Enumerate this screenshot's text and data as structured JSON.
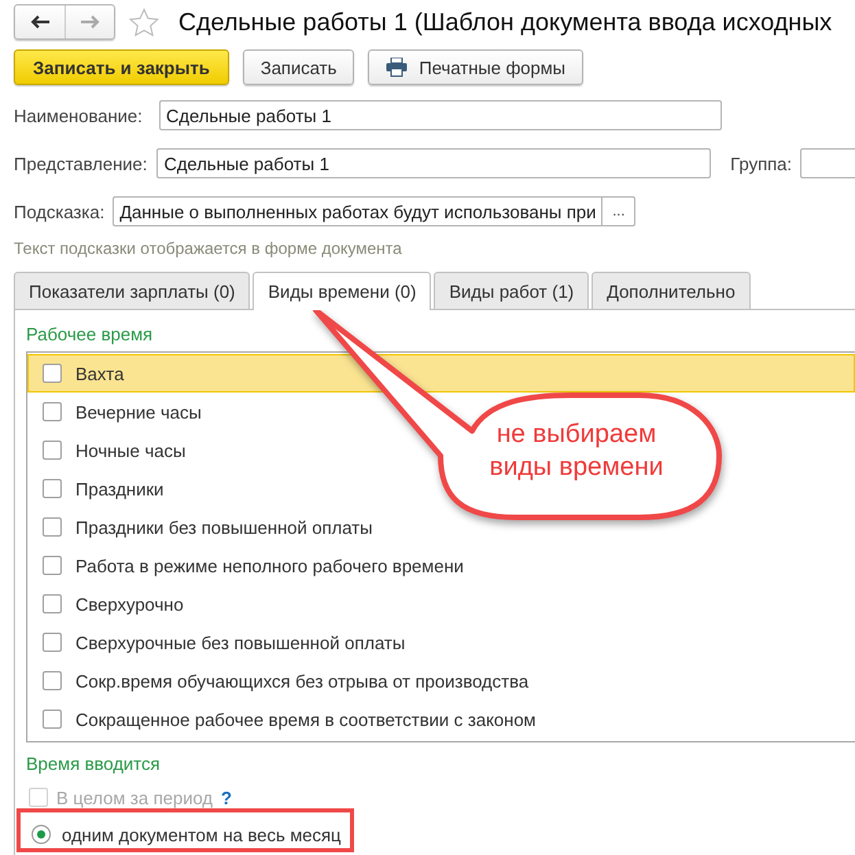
{
  "window": {
    "title": "Сдельные работы 1 (Шаблон документа ввода исходных"
  },
  "buttons": [
    {
      "label": "Записать и закрыть",
      "kind": "primary"
    },
    {
      "label": "Записать",
      "kind": "normal"
    },
    {
      "label": "Печатные формы",
      "kind": "print"
    }
  ],
  "fields": [
    {
      "label": "Наименование:",
      "value": "Сдельные работы 1"
    },
    {
      "label": "Представление:",
      "value": "Сдельные работы 1",
      "side_label": "Группа:"
    },
    {
      "label": "Подсказка:",
      "value": "Данные о выполненных работах будут использованы при",
      "button": "..."
    }
  ],
  "hint_note": "Текст подсказки отображается в форме документа",
  "tabs": [
    {
      "label": "Показатели зарплаты (0)",
      "selected": false
    },
    {
      "label": "Виды времени (0)",
      "selected": true
    },
    {
      "label": "Виды работ (1)",
      "selected": false
    },
    {
      "label": "Дополнительно",
      "selected": false
    }
  ],
  "working_time": {
    "title": "Рабочее время",
    "items": [
      {
        "label": "Вахта",
        "checked": false,
        "selected": true
      },
      {
        "label": "Вечерние часы",
        "checked": false,
        "selected": false
      },
      {
        "label": "Ночные часы",
        "checked": false,
        "selected": false
      },
      {
        "label": "Праздники",
        "checked": false,
        "selected": false
      },
      {
        "label": "Праздники без повышенной оплаты",
        "checked": false,
        "selected": false
      },
      {
        "label": "Работа в режиме неполного рабочего времени",
        "checked": false,
        "selected": false
      },
      {
        "label": "Сверхурочно",
        "checked": false,
        "selected": false
      },
      {
        "label": "Сверхурочные без повышенной оплаты",
        "checked": false,
        "selected": false
      },
      {
        "label": "Сокр.время обучающихся без отрыва от производства",
        "checked": false,
        "selected": false
      },
      {
        "label": "Сокращенное рабочее время в соответствии с законом",
        "checked": false,
        "selected": false
      }
    ]
  },
  "time_entry": {
    "title": "Время вводится",
    "period_checkbox": {
      "label": "В целом за период",
      "checked": false,
      "disabled": true,
      "help": "?"
    },
    "radio": {
      "label": "одним документом на весь месяц",
      "selected": true
    }
  },
  "callout": {
    "text": "не выбираем виды времени"
  }
}
